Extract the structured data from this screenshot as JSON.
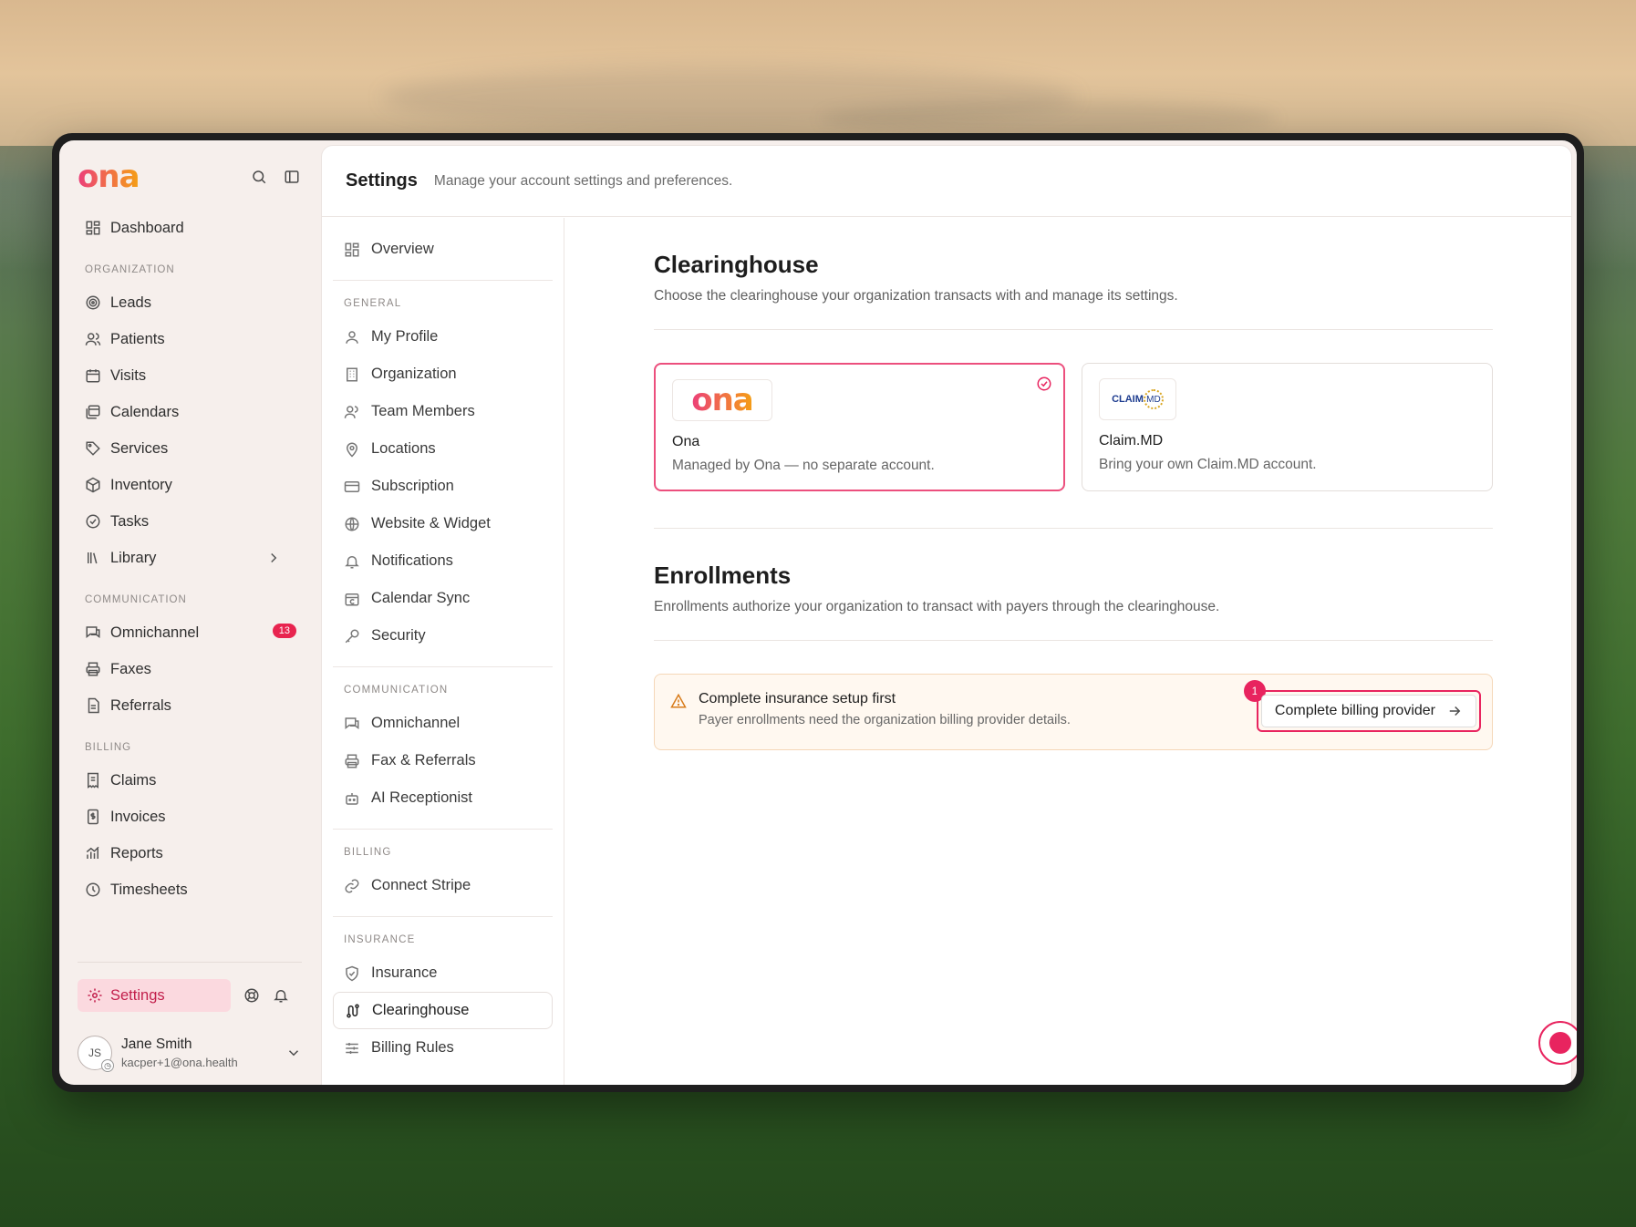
{
  "app": {
    "logo": "ona"
  },
  "sidebar": {
    "dashboard": "Dashboard",
    "sections": {
      "organization": "ORGANIZATION",
      "communication": "COMMUNICATION",
      "billing": "BILLING"
    },
    "org_items": [
      "Leads",
      "Patients",
      "Visits",
      "Calendars",
      "Services",
      "Inventory",
      "Tasks",
      "Library"
    ],
    "comm_items": [
      "Omnichannel",
      "Faxes",
      "Referrals"
    ],
    "omnichannel_badge": "13",
    "billing_items": [
      "Claims",
      "Invoices",
      "Reports",
      "Timesheets"
    ],
    "settings_label": "Settings",
    "user": {
      "initials": "JS",
      "name": "Jane Smith",
      "email": "kacper+1@ona.health"
    }
  },
  "header": {
    "title": "Settings",
    "subtitle": "Manage your account settings and preferences."
  },
  "subnav": {
    "overview": "Overview",
    "general_label": "GENERAL",
    "general": [
      "My Profile",
      "Organization",
      "Team Members",
      "Locations",
      "Subscription",
      "Website & Widget",
      "Notifications",
      "Calendar Sync",
      "Security"
    ],
    "communication_label": "COMMUNICATION",
    "communication": [
      "Omnichannel",
      "Fax & Referrals",
      "AI Receptionist"
    ],
    "billing_label": "BILLING",
    "billing": [
      "Connect Stripe"
    ],
    "insurance_label": "INSURANCE",
    "insurance": [
      "Insurance",
      "Clearinghouse",
      "Billing Rules"
    ]
  },
  "clearinghouse": {
    "title": "Clearinghouse",
    "description": "Choose the clearinghouse your organization transacts with and manage its settings.",
    "options": [
      {
        "name": "Ona",
        "description": "Managed by Ona — no separate account.",
        "selected": true,
        "logo_text": "ona"
      },
      {
        "name": "Claim.MD",
        "description": "Bring your own Claim.MD account.",
        "selected": false,
        "logo_text": "CLAIM",
        "logo_mark": "MD"
      }
    ]
  },
  "enrollments": {
    "title": "Enrollments",
    "description": "Enrollments authorize your organization to transact with payers through the clearinghouse.",
    "alert": {
      "title": "Complete insurance setup first",
      "description": "Payer enrollments need the organization billing provider details.",
      "button": "Complete billing provider",
      "step": "1"
    }
  },
  "colors": {
    "accent": "#e8245f",
    "brand_start": "#ec3f7a",
    "brand_end": "#f5a014",
    "warning": "#d87b1a"
  }
}
